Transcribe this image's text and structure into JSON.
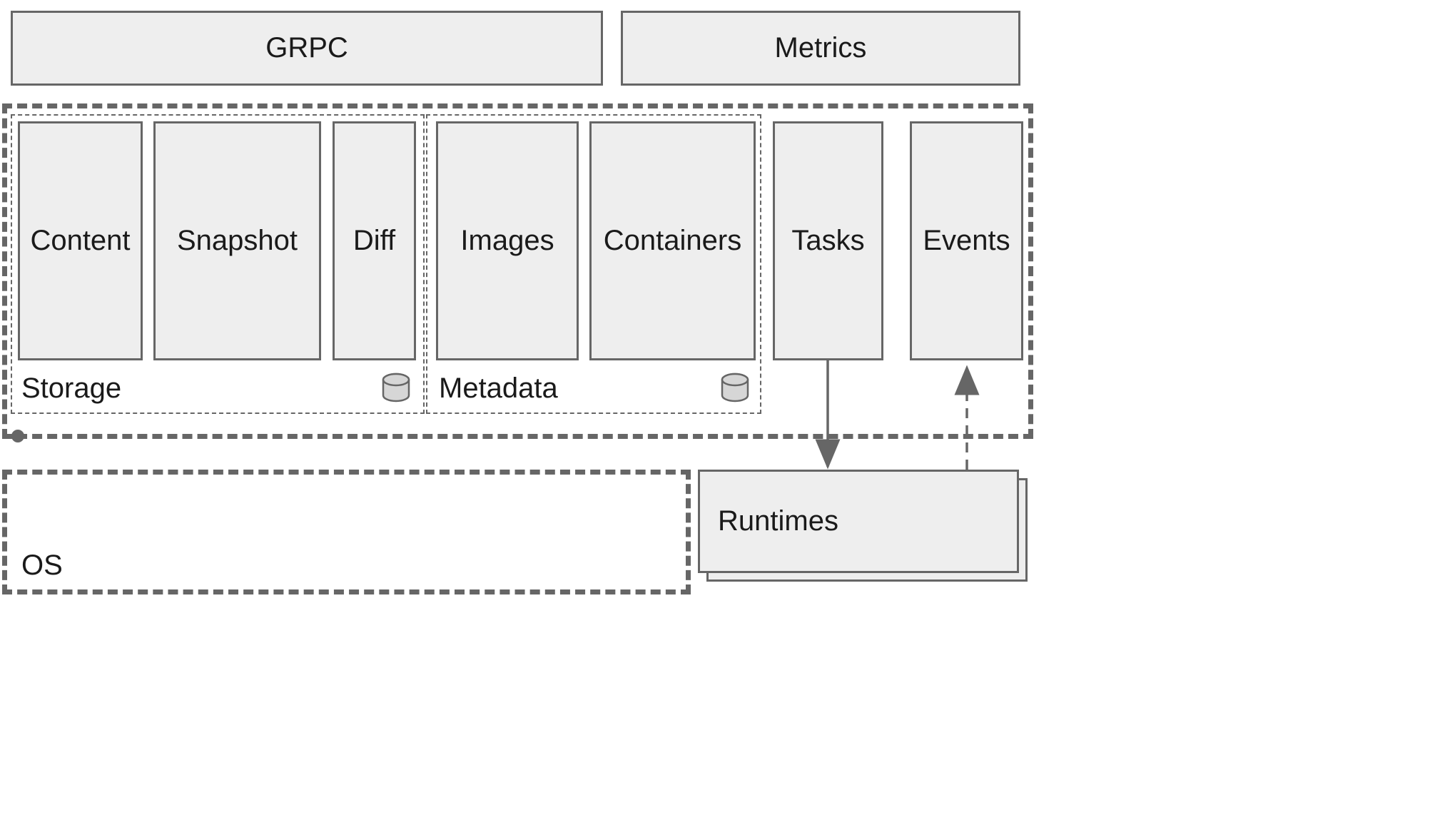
{
  "top": {
    "grpc": "GRPC",
    "metrics": "Metrics"
  },
  "middle": {
    "storage": {
      "label": "Storage",
      "content": "Content",
      "snapshot": "Snapshot",
      "diff": "Diff"
    },
    "metadata": {
      "label": "Metadata",
      "images": "Images",
      "containers": "Containers"
    },
    "tasks": "Tasks",
    "events": "Events"
  },
  "bottom": {
    "os": "OS",
    "runtimes": "Runtimes"
  }
}
